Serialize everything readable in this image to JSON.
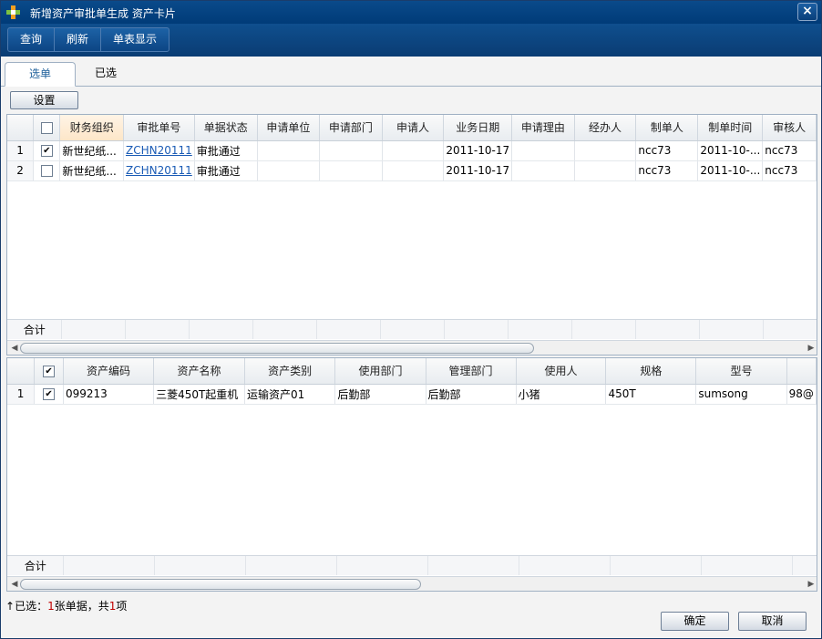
{
  "window": {
    "title": "新增资产审批单生成 资产卡片",
    "close": "×"
  },
  "toolbar": {
    "query": "查询",
    "refresh": "刷新",
    "single_view": "单表显示"
  },
  "tabs": {
    "select": "选单",
    "selected": "已选"
  },
  "settings_label": "设置",
  "upper": {
    "columns": [
      "财务组织",
      "审批单号",
      "单据状态",
      "申请单位",
      "申请部门",
      "申请人",
      "业务日期",
      "申请理由",
      "经办人",
      "制单人",
      "制单时间",
      "审核人"
    ],
    "rows": [
      {
        "no": "1",
        "checked": true,
        "cells": [
          "新世纪纸...",
          "ZCHN20111",
          "审批通过",
          "",
          "",
          "",
          "2011-10-17",
          "",
          "",
          "ncc73",
          "2011-10-...",
          "ncc73"
        ]
      },
      {
        "no": "2",
        "checked": false,
        "cells": [
          "新世纪纸...",
          "ZCHN20111",
          "审批通过",
          "",
          "",
          "",
          "2011-10-17",
          "",
          "",
          "ncc73",
          "2011-10-...",
          "ncc73"
        ]
      }
    ],
    "sum_label": "合计"
  },
  "lower": {
    "columns": [
      "资产编码",
      "资产名称",
      "资产类别",
      "使用部门",
      "管理部门",
      "使用人",
      "规格",
      "型号"
    ],
    "rows": [
      {
        "no": "1",
        "checked": true,
        "cells": [
          "099213",
          "三菱450T起重机",
          "运输资产01",
          "后勤部",
          "后勤部",
          "小猪",
          "450T",
          "sumsong",
          "98@"
        ]
      }
    ],
    "sum_label": "合计"
  },
  "status": {
    "prefix": "已选：",
    "count_sheets": "1",
    "mid": "张单据，共",
    "count_items": "1",
    "suffix": "项"
  },
  "buttons": {
    "ok": "确定",
    "cancel": "取消"
  }
}
